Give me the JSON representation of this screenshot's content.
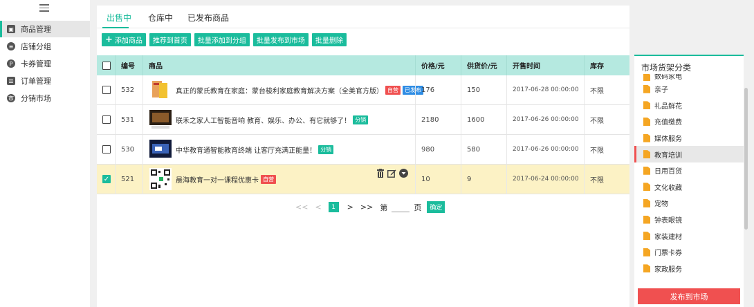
{
  "sidebar": {
    "items": [
      {
        "label": "商品管理",
        "icon": "product-icon"
      },
      {
        "label": "店铺分组",
        "icon": "group-icon"
      },
      {
        "label": "卡券管理",
        "icon": "coupon-icon"
      },
      {
        "label": "订单管理",
        "icon": "order-icon"
      },
      {
        "label": "分销市场",
        "icon": "market-icon"
      }
    ]
  },
  "tabs": [
    "出售中",
    "仓库中",
    "已发布商品"
  ],
  "toolbar": {
    "add_label": "添加商品",
    "recommend_label": "推荐到首页",
    "batch_group_label": "批量添加到分组",
    "batch_publish_label": "批量发布到市场",
    "batch_delete_label": "批量删除"
  },
  "table": {
    "headers": {
      "id": "编号",
      "product": "商品",
      "price": "价格/元",
      "supply": "供货价/元",
      "time": "开售时间",
      "stock": "库存"
    },
    "rows": [
      {
        "id": "532",
        "name": "真正的蒙氏教育在家庭：蒙台梭利家庭教育解决方案（全美官方版）",
        "tags": [
          {
            "text": "自营",
            "color": "red"
          },
          {
            "text": "已发布",
            "color": "blue"
          }
        ],
        "price": "176",
        "supply": "150",
        "time": "2017-06-28 00:00:00",
        "stock": "不限",
        "checked": false
      },
      {
        "id": "531",
        "name": "联禾之家人工智能音响 教育、娱乐、办公、有它就够了！",
        "tags": [
          {
            "text": "分销",
            "color": "green"
          }
        ],
        "price": "2180",
        "supply": "1600",
        "time": "2017-06-26 00:00:00",
        "stock": "不限",
        "checked": false
      },
      {
        "id": "530",
        "name": "中华教育通智能教育终端 让客厅充满正能量！",
        "tags": [
          {
            "text": "分销",
            "color": "green"
          }
        ],
        "price": "980",
        "supply": "580",
        "time": "2017-06-26 00:00:00",
        "stock": "不限",
        "checked": false
      },
      {
        "id": "521",
        "name": "晨海教育一对一课程优惠卡",
        "tags": [
          {
            "text": "自营",
            "color": "red"
          }
        ],
        "price": "10",
        "supply": "9",
        "time": "2017-06-24 00:00:00",
        "stock": "不限",
        "checked": true
      }
    ]
  },
  "pager": {
    "first": "<<",
    "prev": "<",
    "current": "1",
    "next": ">",
    "last": ">>",
    "goto_prefix": "第",
    "goto_suffix": "页",
    "confirm": "确定"
  },
  "right_panel": {
    "title": "市场货架分类",
    "categories": [
      "数码家电",
      "亲子",
      "礼品鲜花",
      "充值缴费",
      "媒体服务",
      "教育培训",
      "日用百货",
      "文化收藏",
      "宠物",
      "钟表眼镜",
      "家装建材",
      "门票卡券",
      "家政服务"
    ],
    "active_category": "教育培训",
    "publish_label": "发布到市场"
  },
  "colors": {
    "accent": "#1abc9c",
    "danger": "#f05050",
    "header_bg": "#b5e9e0",
    "selected_row": "#fcf2c5"
  }
}
